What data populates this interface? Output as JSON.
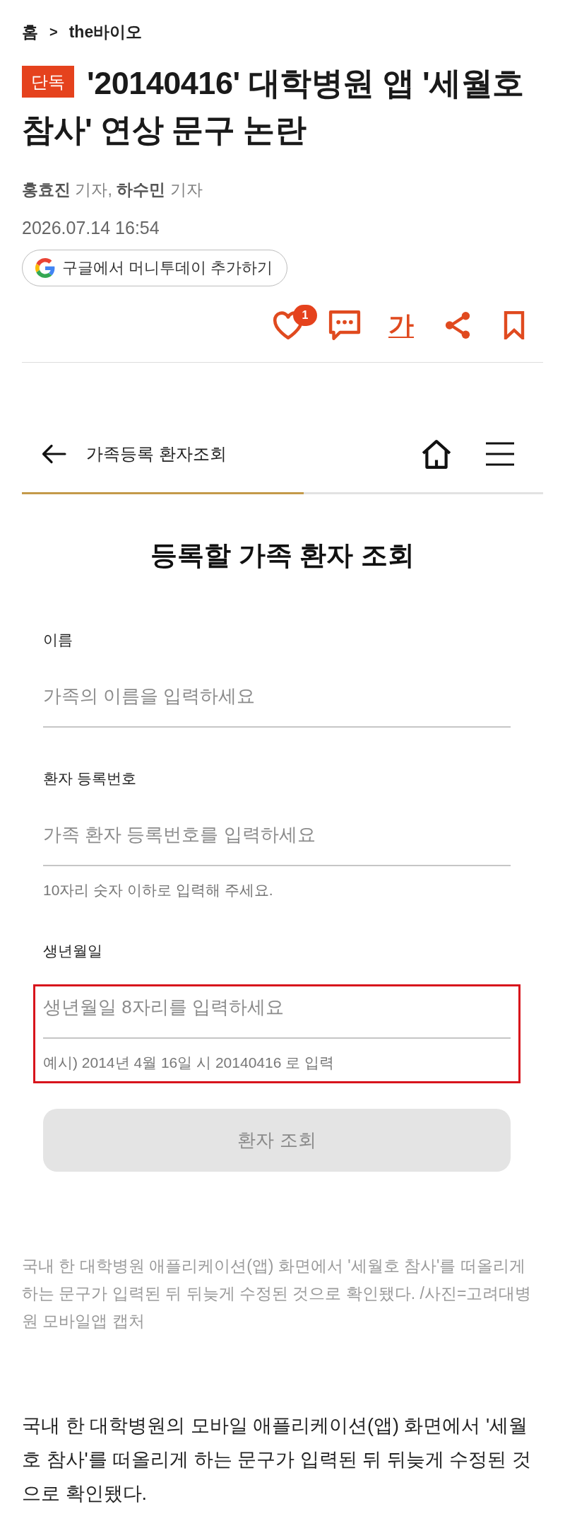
{
  "breadcrumb": {
    "items": [
      "홈",
      "the바이오"
    ],
    "separator": ">"
  },
  "headline": {
    "tag": "단독",
    "title": "'20140416' 대학병원 앱 '세월호 참사' 연상 문구 논란"
  },
  "byline": "**홍효진** 기자, **하수민** 기자",
  "date": "2026.07.14 16:54",
  "follow_button": {
    "label": "구글에서 머니투데이 추가하기"
  },
  "actions": [
    {
      "kind": "like",
      "badge": "1"
    },
    {
      "kind": "comment"
    },
    {
      "kind": "text_size",
      "label": "가"
    },
    {
      "kind": "share"
    },
    {
      "kind": "bookmark"
    }
  ],
  "screenshot": {
    "header": {
      "title": "가족등록 환자조회"
    },
    "progress": {
      "level": 0.54
    },
    "heading": "등록할 가족 환자 조회",
    "fields": [
      {
        "label": "이름",
        "placeholder": "가족의 이름을 입력하세요",
        "highlighted": false
      },
      {
        "label": "환자 등록번호",
        "placeholder": "가족 환자 등록번호를 입력하세요",
        "hint": "10자리 숫자 이하로 입력해 주세요.",
        "highlighted": false
      },
      {
        "label": "생년월일",
        "placeholder": "생년월일 8자리를 입력하세요",
        "hint": "예시) 2014년 4월 16일 시 20140416 로 입력",
        "highlighted": true
      }
    ],
    "submit": {
      "label": "환자 조회",
      "disabled": true
    }
  },
  "caption": "국내 한 대학병원 애플리케이션(앱) 화면에서 '세월호 참사'를 떠올리게 하는 문구가 입력된 뒤 뒤늦게 수정된 것으로 확인됐다. /사진=고려대병원 모바일앱 캡처",
  "body": "국내 한 대학병원의 모바일 애플리케이션(앱) 화면에서 '세월호 참사'를 떠올리게 하는 문구가 입력된 뒤 뒤늦게 수정된 것으로 확인됐다."
}
